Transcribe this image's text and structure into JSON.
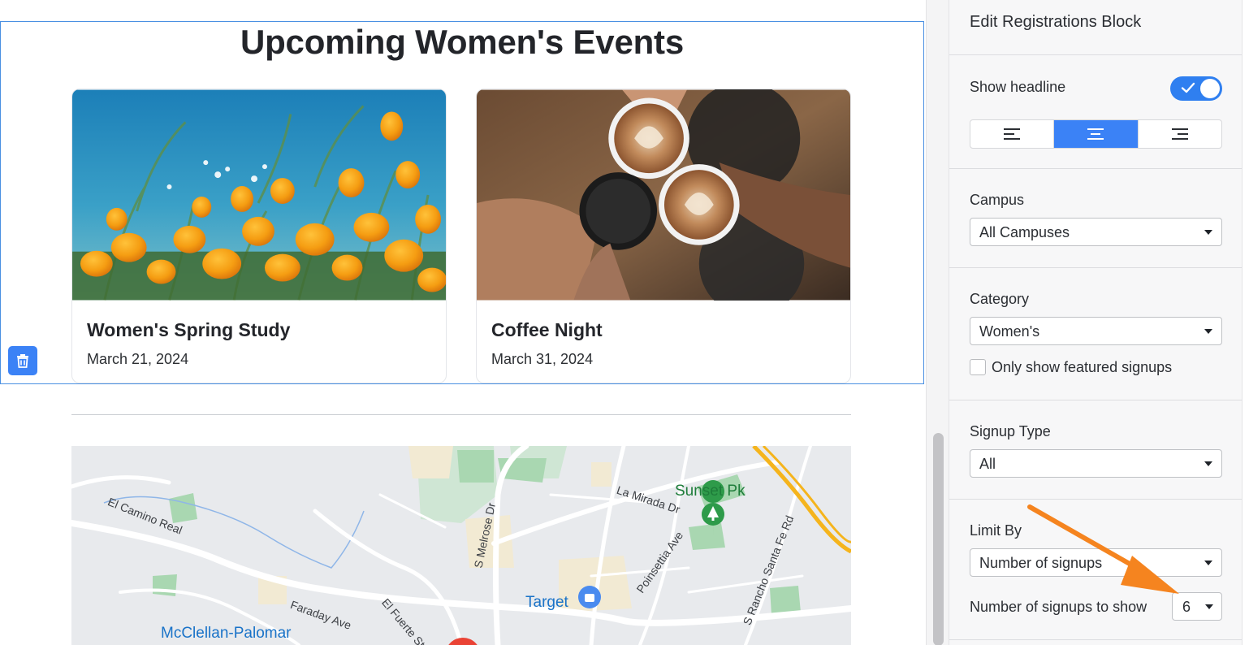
{
  "canvas": {
    "headline": "Upcoming Women's Events",
    "events": [
      {
        "title": "Women's Spring Study",
        "date": "March 21, 2024",
        "image": "orange-poppies-photo"
      },
      {
        "title": "Coffee Night",
        "date": "March 31, 2024",
        "image": "coffee-cups-cheers-photo"
      }
    ],
    "delete_icon": "trash-icon",
    "map": {
      "labels": {
        "el_camino_real": "El Camino Real",
        "s_melrose_dr": "S Melrose Dr",
        "la_mirada_dr": "La Mirada Dr",
        "sunset_pk": "Sunset Pk",
        "s_rancho_santa_fe_rd": "S Rancho Santa Fe Rd",
        "poinsettia_ave": "Poinsettia Ave",
        "target": "Target",
        "faraday_ave": "Faraday Ave",
        "el_fuerte_st": "El Fuerte St",
        "mcclellan_palomar": "McClellan-Palomar"
      }
    }
  },
  "panel": {
    "title": "Edit Registrations Block",
    "show_headline": {
      "label": "Show headline",
      "enabled": true
    },
    "alignment": {
      "options": [
        "align-left-icon",
        "align-center-icon",
        "align-right-icon"
      ],
      "selected": "center"
    },
    "campus": {
      "label": "Campus",
      "value": "All Campuses"
    },
    "category": {
      "label": "Category",
      "value": "Women's"
    },
    "featured_only": {
      "label": "Only show featured signups",
      "checked": false
    },
    "signup_type": {
      "label": "Signup Type",
      "value": "All"
    },
    "limit_by": {
      "label": "Limit By",
      "value": "Number of signups"
    },
    "signups_to_show": {
      "label": "Number of signups to show",
      "value": "6"
    }
  },
  "colors": {
    "accent": "#3b82f6",
    "annotation_arrow": "#f5841f",
    "selection_outline": "#4a90e2"
  }
}
